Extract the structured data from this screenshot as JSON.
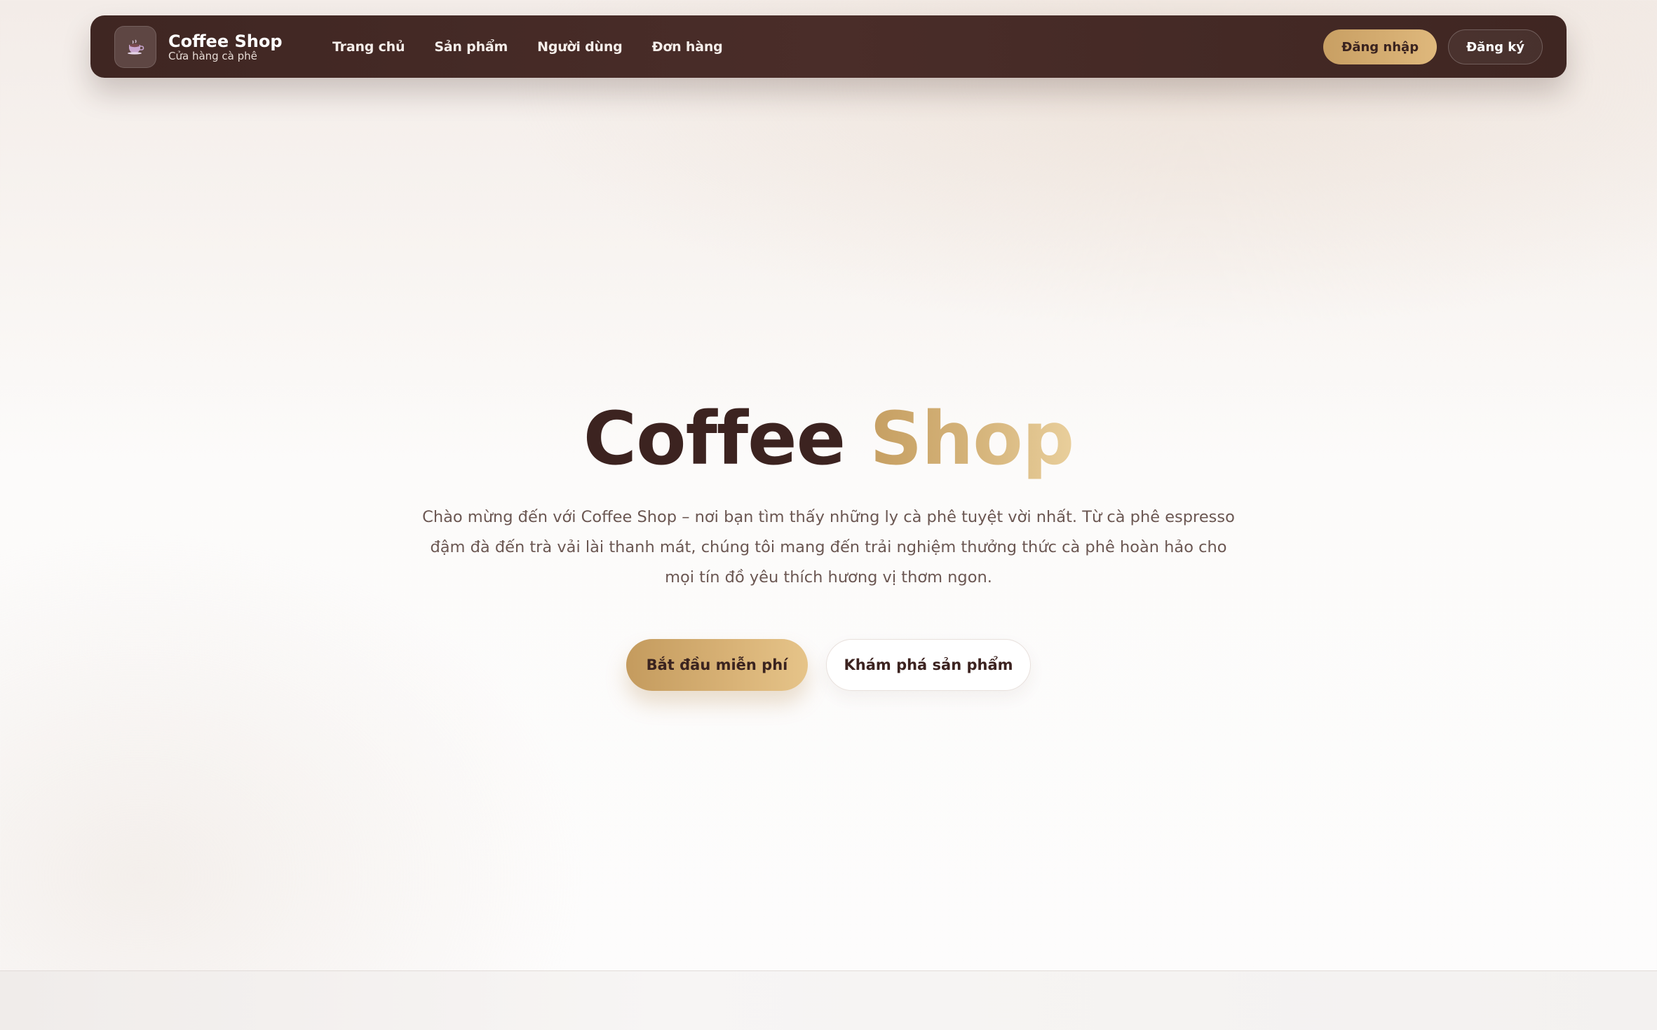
{
  "brand": {
    "title": "Coffee Shop",
    "subtitle": "Cửa hàng cà phê",
    "logo_icon": "coffee-cup-icon"
  },
  "nav": {
    "items": [
      {
        "label": "Trang chủ"
      },
      {
        "label": "Sản phẩm"
      },
      {
        "label": "Người dùng"
      },
      {
        "label": "Đơn hàng"
      }
    ],
    "login_label": "Đăng nhập",
    "register_label": "Đăng ký"
  },
  "hero": {
    "title_part1": "Coffee",
    "title_part2": "Shop",
    "description": "Chào mừng đến với Coffee Shop – nơi bạn tìm thấy những ly cà phê tuyệt vời nhất. Từ cà phê espresso đậm đà đến trà vải lài thanh mát, chúng tôi mang đến trải nghiệm thưởng thức cà phê hoàn hảo cho mọi tín đồ yêu thích hương vị thơm ngon.",
    "primary_cta": "Bắt đầu miễn phí",
    "secondary_cta": "Khám phá sản phẩm"
  },
  "colors": {
    "nav_bg": "#45292a",
    "accent_gold": "#d4ad72",
    "title_dark": "#3c2320",
    "text_muted": "#6b5752"
  }
}
